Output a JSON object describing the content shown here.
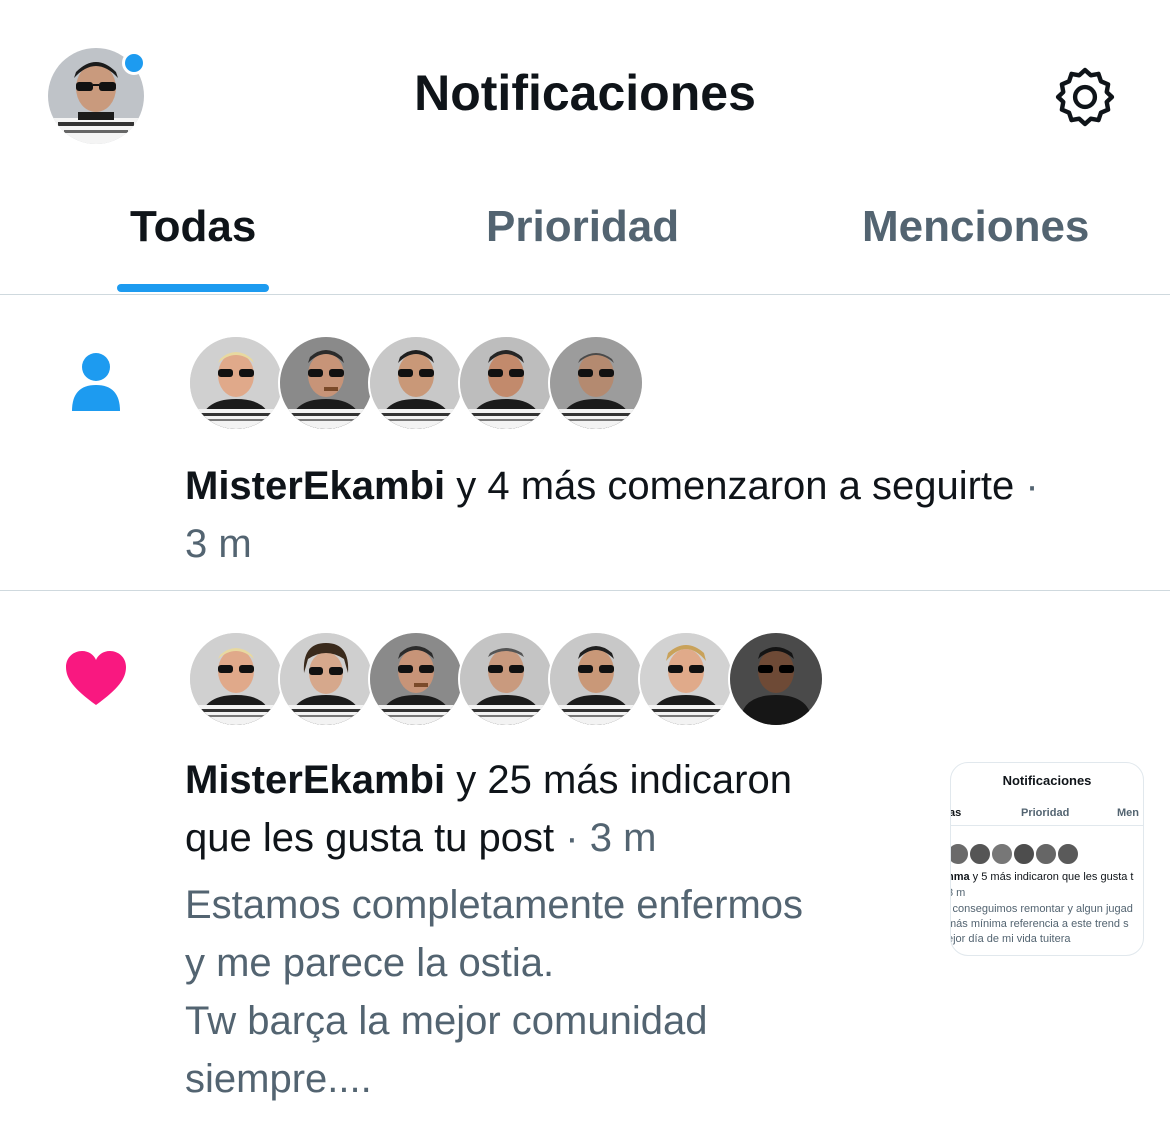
{
  "header": {
    "title": "Notificaciones"
  },
  "tabs": [
    {
      "label": "Todas",
      "active": true
    },
    {
      "label": "Prioridad",
      "active": false
    },
    {
      "label": "Menciones",
      "active": false
    }
  ],
  "notifications": [
    {
      "type": "follow",
      "icon": "person-icon",
      "avatar_count": 5,
      "user": "MisterEkambi",
      "text": "y 4 más comenzaron a seguirte",
      "separator": "·",
      "time": "3 m"
    },
    {
      "type": "like",
      "icon": "heart-icon",
      "avatar_count": 7,
      "user": "MisterEkambi",
      "text_line1": "y 25 más indicaron",
      "text_line2": "que les gusta tu post",
      "separator": "·",
      "time": "3 m",
      "post_excerpt": "Estamos completamente enfermos\ny me parece la ostia.\nTw barça la mejor comunidad\nsiempre....",
      "thumbnail": {
        "title": "Notificaciones",
        "tab_left": "as",
        "tab_mid": "Prioridad",
        "tab_right": "Men",
        "line1_bold": "nma",
        "line1_rest": " y 5 más indicaron que les gusta t",
        "line2": "3 m",
        "line3": "i conseguimos remontar y algun jugad",
        "line4": "más mínima referencia a este trend s",
        "line5": "ejor día de mi vida tuitera"
      }
    }
  ],
  "colors": {
    "accent": "#1d9bf0",
    "like": "#f91880",
    "muted": "#536471",
    "text": "#0f1419",
    "border": "#cfd9de"
  }
}
